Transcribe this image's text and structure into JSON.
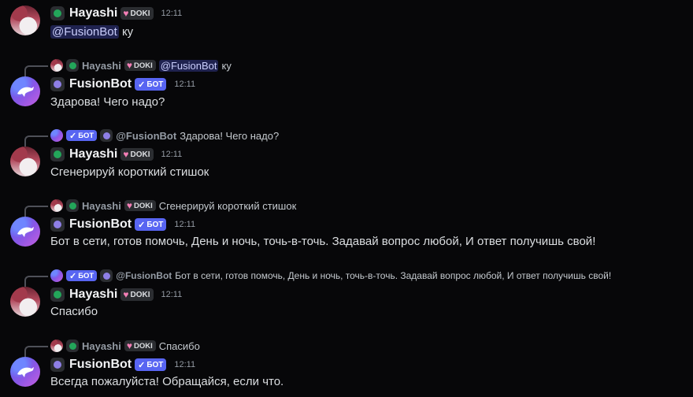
{
  "users": {
    "hayashi": {
      "name": "Hayashi",
      "tag": "DOKI"
    },
    "bot": {
      "name": "FusionBot",
      "tag": "БОТ"
    }
  },
  "messages": [
    {
      "author": "hayashi",
      "time": "12:11",
      "mention": "@FusionBot",
      "text": "ку"
    },
    {
      "author": "bot",
      "time": "12:11",
      "reply_author": "Hayashi",
      "reply_mention": "@FusionBot",
      "reply_text": "ку",
      "text": "Здарова! Чего надо?"
    },
    {
      "author": "hayashi",
      "time": "12:11",
      "reply_author": "@FusionBot",
      "reply_text": "Здарова! Чего надо?",
      "text": "Сгенерируй короткий стишок"
    },
    {
      "author": "bot",
      "time": "12:11",
      "reply_author": "Hayashi",
      "reply_text": "Сгенерируй короткий стишок",
      "text": "Бот в сети, готов помочь, День и ночь, точь-в-точь. Задавай вопрос любой, И ответ получишь свой!"
    },
    {
      "author": "hayashi",
      "time": "12:11",
      "reply_author": "@FusionBot",
      "reply_text": "Бот в сети, готов помочь, День и ночь, точь-в-точь. Задавай вопрос любой, И ответ получишь свой!",
      "text": "Спасибо"
    },
    {
      "author": "bot",
      "time": "12:11",
      "reply_author": "Hayashi",
      "reply_text": "Спасибо",
      "text": "Всегда пожалуйста! Обращайся, если что."
    }
  ],
  "colors": {
    "background": "#070709",
    "bot_tag": "#5865f2",
    "mention_bg": "#353a6b",
    "online": "#23a55a"
  }
}
